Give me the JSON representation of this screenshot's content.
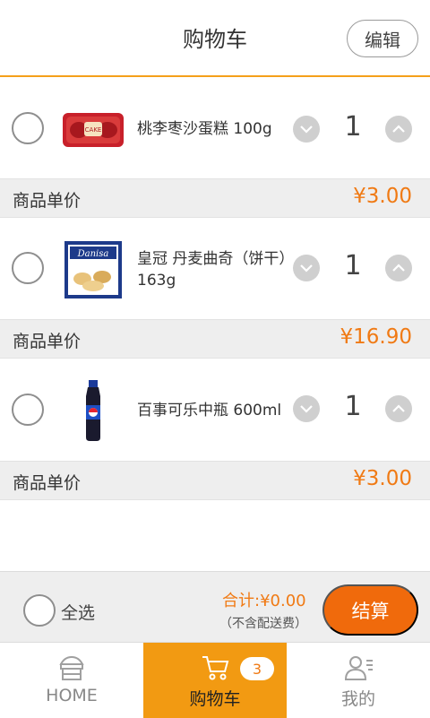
{
  "header": {
    "title": "购物车",
    "edit_label": "编辑"
  },
  "items": [
    {
      "name": "桃李枣沙蛋糕 100g",
      "quantity": "1",
      "price_label": "商品单价",
      "price": "¥3.00",
      "thumb_icon": "cake-product-image",
      "thumb_text": "CAKE"
    },
    {
      "name": "皇冠 丹麦曲奇（饼干）163g",
      "quantity": "1",
      "price_label": "商品单价",
      "price": "¥16.90",
      "thumb_icon": "danisa-cookie-tin-image",
      "thumb_text": "Danisa"
    },
    {
      "name": "百事可乐中瓶 600ml",
      "quantity": "1",
      "price_label": "商品单价",
      "price": "¥3.00",
      "thumb_icon": "pepsi-bottle-image"
    }
  ],
  "checkout": {
    "select_all_label": "全选",
    "total": "合计:¥0.00",
    "fee_note": "（不含配送费）",
    "pay_label": "结算"
  },
  "tabs": [
    {
      "label": "HOME",
      "icon": "store-icon"
    },
    {
      "label": "购物车",
      "icon": "cart-icon",
      "badge": "3",
      "active": true
    },
    {
      "label": "我的",
      "icon": "profile-icon"
    }
  ],
  "colors": {
    "accent": "#f5a01a",
    "price": "#f07a14",
    "pay_button": "#f06a0c",
    "active_tab": "#f29a12"
  }
}
